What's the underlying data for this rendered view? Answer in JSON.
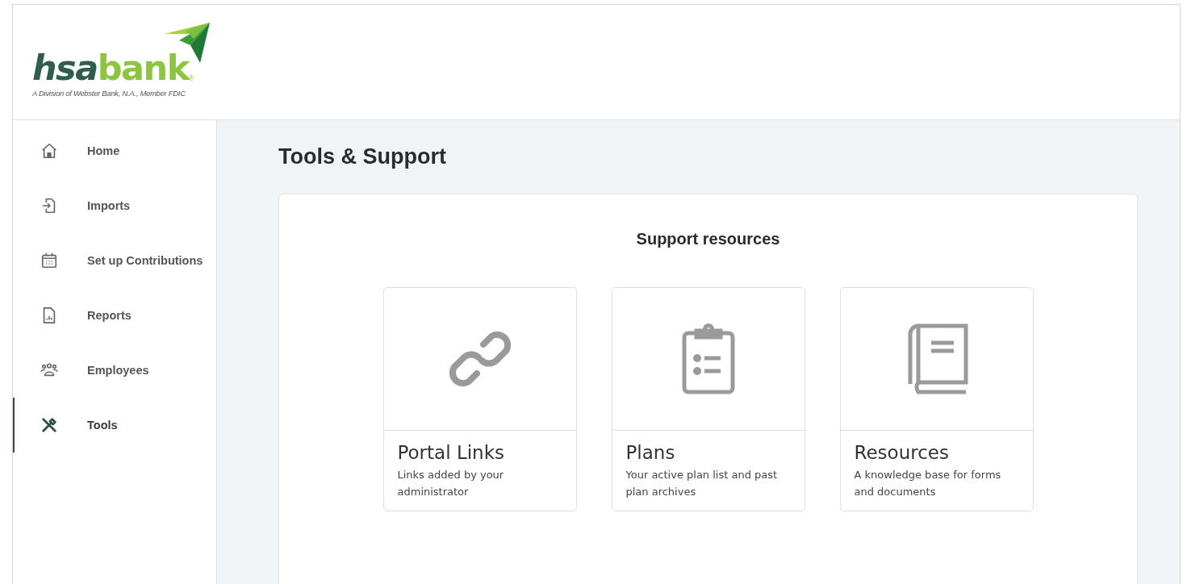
{
  "logo": {
    "dark": "hsa",
    "light": "bank",
    "mark": "®",
    "tagline": "A Division of Webster Bank, N.A., Member FDIC"
  },
  "sidebar": {
    "items": [
      {
        "label": "Home",
        "selected": false
      },
      {
        "label": "Imports",
        "selected": false
      },
      {
        "label": "Set up Contributions",
        "selected": false
      },
      {
        "label": "Reports",
        "selected": false
      },
      {
        "label": "Employees",
        "selected": false
      },
      {
        "label": "Tools",
        "selected": true
      }
    ]
  },
  "page": {
    "title": "Tools & Support"
  },
  "panel": {
    "heading": "Support resources",
    "cards": [
      {
        "title": "Portal Links",
        "description": "Links added by your administrator"
      },
      {
        "title": "Plans",
        "description": "Your active plan list and past plan archives"
      },
      {
        "title": "Resources",
        "description": "A knowledge base for forms and documents"
      }
    ]
  }
}
